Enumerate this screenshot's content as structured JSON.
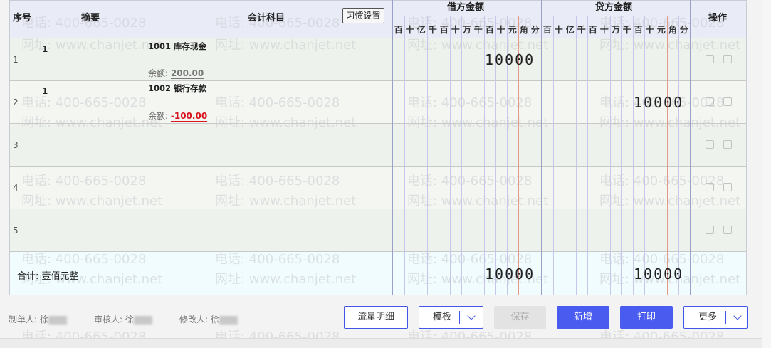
{
  "headers": {
    "seq": "序号",
    "summary": "摘要",
    "subject": "会计科目",
    "debit": "借方金额",
    "credit": "贷方金额",
    "ops": "操作"
  },
  "habit_button": "习惯设置",
  "units": [
    "百",
    "十",
    "亿",
    "千",
    "百",
    "十",
    "万",
    "千",
    "百",
    "十",
    "元",
    "角",
    "分"
  ],
  "rows": [
    {
      "seq": "1",
      "summary": "1",
      "subject": "1001 库存现金",
      "balance_label": "余额:",
      "balance": "200.00",
      "debit": "10000",
      "credit": ""
    },
    {
      "seq": "2",
      "summary": "1",
      "subject": "1002 银行存款",
      "balance_label": "余额:",
      "balance": "-100.00",
      "debit": "",
      "credit": "10000"
    },
    {
      "seq": "3"
    },
    {
      "seq": "4"
    },
    {
      "seq": "5"
    }
  ],
  "total": {
    "label": "合计:  壹佰元整",
    "debit": "10000",
    "credit": "10000"
  },
  "watermark": {
    "phone": "电话: 400-665-0028",
    "site": "网址: www.chanjet.net"
  },
  "footer": {
    "maker": "制单人: 徐",
    "reviewer": "审核人: 徐",
    "modifier": "修改人: 徐"
  },
  "buttons": {
    "flow_detail": "流量明细",
    "template": "模板",
    "save": "保存",
    "add": "新增",
    "print": "打印",
    "more": "更多"
  },
  "colors": {
    "primary": "#4a5bf0",
    "negative": "#d8151f",
    "yuan_line": "#e49a8a"
  }
}
